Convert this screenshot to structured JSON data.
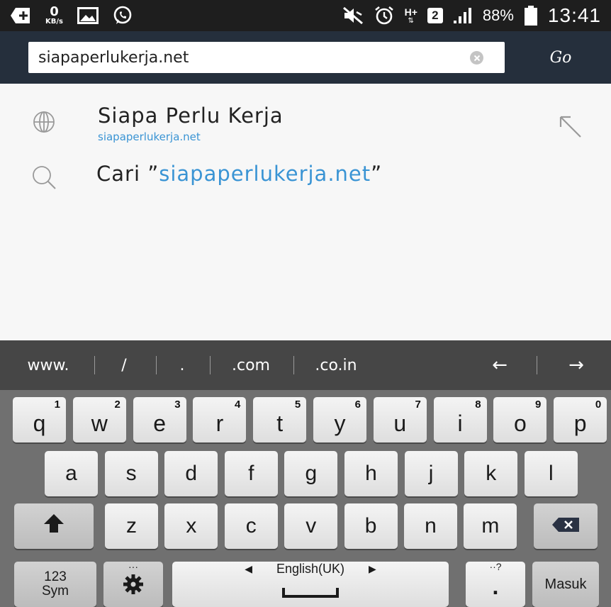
{
  "status_bar": {
    "kbs_value": "0",
    "kbs_unit": "KB/s",
    "network_type": "H+",
    "sim_slot": "2",
    "battery_percent": "88%",
    "time": "13:41",
    "icons": [
      "plus-badge-icon",
      "gallery-icon",
      "whatsapp-icon",
      "mute-icon",
      "alarm-icon",
      "signal-icon",
      "battery-icon"
    ]
  },
  "url_bar": {
    "value": "siapaperlukerja.net",
    "go_label": "Go"
  },
  "suggestions": {
    "site": {
      "title": "Siapa Perlu Kerja",
      "url": "siapaperlukerja.net"
    },
    "search": {
      "prefix": "Cari ”",
      "query": "siapaperlukerja.net",
      "suffix": "”"
    }
  },
  "keyboard": {
    "toolbar": [
      "www.",
      "/",
      ".",
      ".com",
      ".co.in"
    ],
    "arrow_left": "←",
    "arrow_right": "→",
    "row1": [
      {
        "letter": "q",
        "num": "1"
      },
      {
        "letter": "w",
        "num": "2"
      },
      {
        "letter": "e",
        "num": "3"
      },
      {
        "letter": "r",
        "num": "4"
      },
      {
        "letter": "t",
        "num": "5"
      },
      {
        "letter": "y",
        "num": "6"
      },
      {
        "letter": "u",
        "num": "7"
      },
      {
        "letter": "i",
        "num": "8"
      },
      {
        "letter": "o",
        "num": "9"
      },
      {
        "letter": "p",
        "num": "0"
      }
    ],
    "row2": [
      "a",
      "s",
      "d",
      "f",
      "g",
      "h",
      "j",
      "k",
      "l"
    ],
    "row3": [
      "z",
      "x",
      "c",
      "v",
      "b",
      "n",
      "m"
    ],
    "sym_label_1": "123",
    "sym_label_2": "Sym",
    "space_label": "English(UK)",
    "period_label": ".",
    "period_hint": "··?",
    "enter_label": "Masuk"
  }
}
